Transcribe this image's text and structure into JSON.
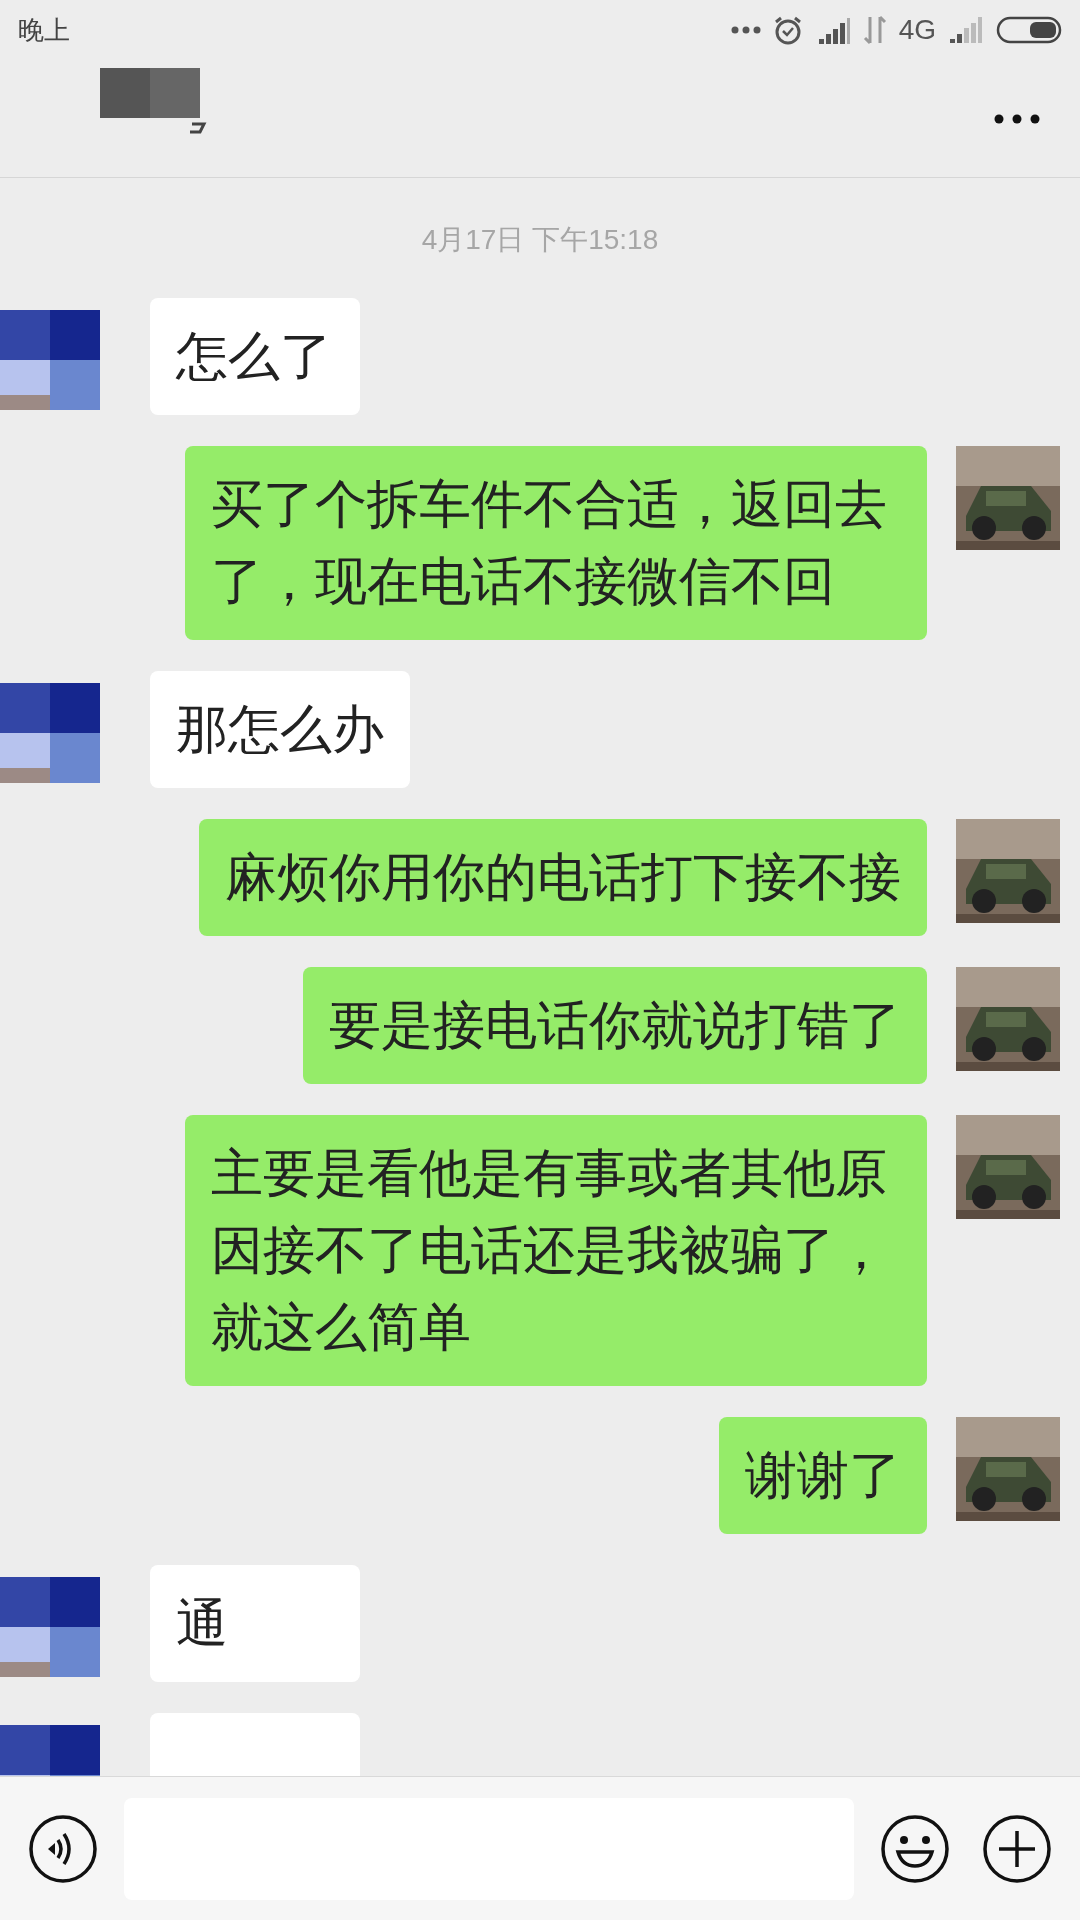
{
  "status_bar": {
    "time": "晚上",
    "network": "4G"
  },
  "timestamp": "4月17日 下午15:18",
  "messages": [
    {
      "kind": "received",
      "text": "怎么了"
    },
    {
      "kind": "sent",
      "text": "买了个拆车件不合适，返回去了，现在电话不接微信不回"
    },
    {
      "kind": "received",
      "text": "那怎么办"
    },
    {
      "kind": "sent",
      "text": "麻烦你用你的电话打下接不接"
    },
    {
      "kind": "sent",
      "text": "要是接电话你就说打错了"
    },
    {
      "kind": "sent",
      "text": "主要是看他是有事或者其他原因接不了电话还是我被骗了，就这么简单"
    },
    {
      "kind": "sent",
      "text": "谢谢了"
    },
    {
      "kind": "received",
      "text": "通"
    },
    {
      "kind": "received"
    }
  ]
}
